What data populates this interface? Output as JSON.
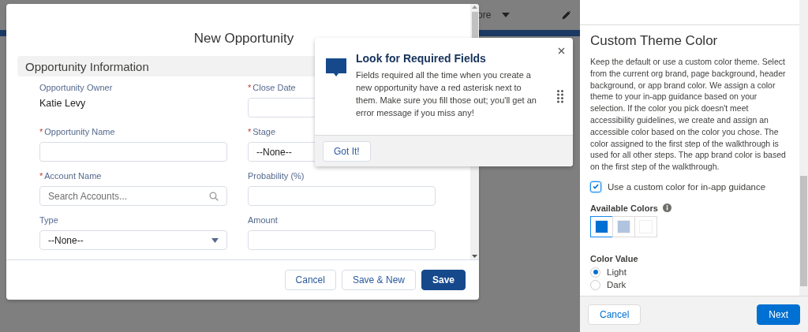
{
  "background": {
    "menu_label": "ore"
  },
  "modal": {
    "title": "New Opportunity",
    "section": "Opportunity Information",
    "fields": [
      {
        "kind": "static",
        "label": "Opportunity Owner",
        "value": "Katie Levy"
      },
      {
        "kind": "text",
        "label": "Close Date",
        "required_mark": "*"
      },
      {
        "kind": "text",
        "label": "Opportunity Name",
        "required_mark": "*"
      },
      {
        "kind": "select",
        "label": "Stage",
        "required_mark": "*",
        "value": "--None--"
      },
      {
        "kind": "search",
        "label": "Account Name",
        "required_mark": "*",
        "placeholder": "Search Accounts..."
      },
      {
        "kind": "text",
        "label": "Probability (%)"
      },
      {
        "kind": "select",
        "label": "Type",
        "value": "--None--"
      },
      {
        "kind": "text",
        "label": "Amount"
      }
    ],
    "buttons": [
      {
        "label": "Cancel",
        "kind": "neutral"
      },
      {
        "label": "Save & New",
        "kind": "neutral"
      },
      {
        "label": "Save",
        "kind": "brand"
      }
    ]
  },
  "popover": {
    "title": "Look for Required Fields",
    "body": "Fields required all the time when you create a new opportunity have a red asterisk next to them. Make sure you fill those out; you'll get an error message if you miss any!",
    "button": "Got It!"
  },
  "panel": {
    "title": "Custom Theme Color",
    "description": "Keep the default or use a custom color theme. Select from the current org brand, page background, header background, or app brand color. We assign a color theme to your in-app guidance based on your selection. If the color you pick doesn't meet accessibility guidelines, we create and assign an accessible color based on the color you chose. The color assigned to the first step of the walkthrough is used for all other steps. The app brand color is based on the first step of the walkthrough.",
    "checkbox": {
      "label": "Use a custom color for in-app guidance",
      "checked": true
    },
    "colors": {
      "label": "Available Colors",
      "swatches": [
        {
          "color": "#0070d2",
          "selected": true
        },
        {
          "color": "#b0c4df",
          "selected": false
        },
        {
          "color": "#ffffff",
          "selected": false
        }
      ]
    },
    "color_value": {
      "label": "Color Value",
      "options": [
        {
          "label": "Light",
          "selected": true
        },
        {
          "label": "Dark",
          "selected": false
        }
      ]
    },
    "buttons": [
      {
        "label": "Cancel",
        "kind": "neutral"
      },
      {
        "label": "Next",
        "kind": "brand"
      }
    ]
  }
}
